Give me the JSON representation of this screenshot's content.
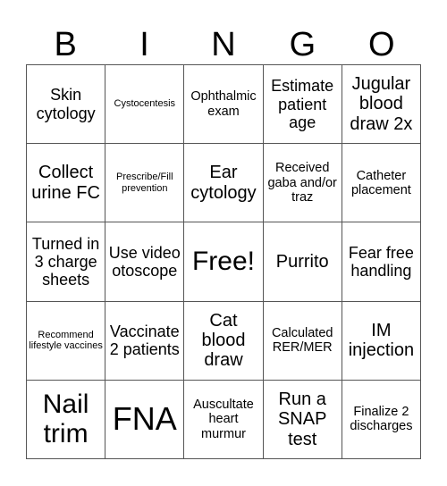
{
  "header": {
    "letters": [
      "B",
      "I",
      "N",
      "G",
      "O"
    ]
  },
  "grid": [
    [
      "Skin cytology",
      "Cystocentesis",
      "Ophthalmic exam",
      "Estimate patient age",
      "Jugular blood draw 2x"
    ],
    [
      "Collect urine FC",
      "Prescribe/Fill prevention",
      "Ear cytology",
      "Received gaba and/or traz",
      "Catheter placement"
    ],
    [
      "Turned in 3 charge sheets",
      "Use video otoscope",
      "Free!",
      "Purrito",
      "Fear free handling"
    ],
    [
      "Recommend lifestyle vaccines",
      "Vaccinate 2 patients",
      "Cat blood draw",
      "Calculated RER/MER",
      "IM injection"
    ],
    [
      "Nail trim",
      "FNA",
      "Auscultate heart murmur",
      "Run a SNAP test",
      "Finalize 2 discharges"
    ]
  ]
}
